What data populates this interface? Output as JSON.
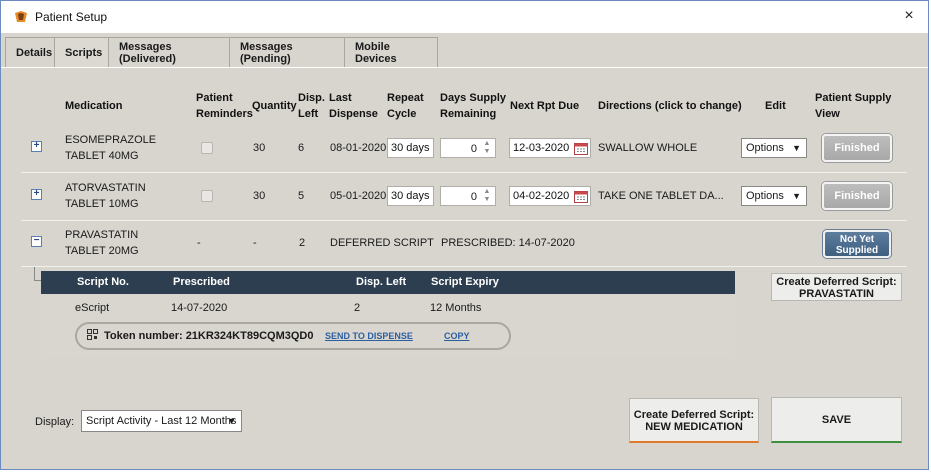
{
  "window": {
    "title": "Patient Setup",
    "close_icon": "×"
  },
  "tabs": [
    {
      "label": "Details"
    },
    {
      "label": "Scripts"
    },
    {
      "label": "Messages (Delivered)"
    },
    {
      "label": "Messages (Pending)"
    },
    {
      "label": "Mobile Devices"
    }
  ],
  "active_tab": "Scripts",
  "columns": {
    "medication": "Medication",
    "patient_reminders_1": "Patient",
    "patient_reminders_2": "Reminders",
    "quantity": "Quantity",
    "disp_left_1": "Disp.",
    "disp_left_2": "Left",
    "last_dispense_1": "Last",
    "last_dispense_2": "Dispense",
    "repeat_cycle_1": "Repeat",
    "repeat_cycle_2": "Cycle",
    "days_supply_1": "Days Supply",
    "days_supply_2": "Remaining",
    "next_rpt_due": "Next Rpt Due",
    "directions": "Directions (click to change)",
    "edit": "Edit",
    "supply_view_1": "Patient Supply",
    "supply_view_2": "View"
  },
  "rows": [
    {
      "expand_icon": "+",
      "med_line1": "ESOMEPRAZOLE",
      "med_line2": "TABLET 40MG",
      "quantity": "30",
      "disp_left": "6",
      "last_dispense": "08-01-2020",
      "repeat_cycle": "30 days",
      "days_supply": "0",
      "next_rpt_due": "12-03-2020",
      "directions": "SWALLOW WHOLE",
      "edit": "Options",
      "status": "Finished"
    },
    {
      "expand_icon": "+",
      "med_line1": "ATORVASTATIN",
      "med_line2": "TABLET 10MG",
      "quantity": "30",
      "disp_left": "5",
      "last_dispense": "05-01-2020",
      "repeat_cycle": "30 days",
      "days_supply": "0",
      "next_rpt_due": "04-02-2020",
      "directions": "TAKE ONE TABLET DA...",
      "edit": "Options",
      "status": "Finished"
    },
    {
      "expand_icon": "−",
      "med_line1": "PRAVASTATIN",
      "med_line2": "TABLET 20MG",
      "reminders": "-",
      "quantity": "-",
      "disp_left": "2",
      "last_dispense": "DEFERRED SCRIPT",
      "prescribed": "PRESCRIBED: 14-07-2020",
      "status_line1": "Not Yet",
      "status_line2": "Supplied"
    }
  ],
  "script_table": {
    "headers": {
      "script_no": "Script No.",
      "prescribed": "Prescribed",
      "disp_left": "Disp. Left",
      "expiry": "Script Expiry"
    },
    "row": {
      "script_no": "eScript",
      "prescribed": "14-07-2020",
      "disp_left": "2",
      "expiry": "12 Months"
    },
    "token_label": "Token number: 21KR324KT89CQM3QD0",
    "send_link": "SEND TO DISPENSE",
    "copy_link": "COPY"
  },
  "create_deferred_pravastatin": {
    "line1": "Create Deferred Script:",
    "line2": "PRAVASTATIN"
  },
  "footer": {
    "display_label": "Display:",
    "display_value": "Script Activity - Last 12 Months",
    "create_new_line1": "Create Deferred Script:",
    "create_new_line2": "NEW MEDICATION",
    "save": "SAVE"
  },
  "colors": {
    "accent_orange": "#e07a2a",
    "accent_green": "#3f8f3f",
    "table_header": "#2d3e50",
    "not_supplied": "#4a6a8c"
  }
}
